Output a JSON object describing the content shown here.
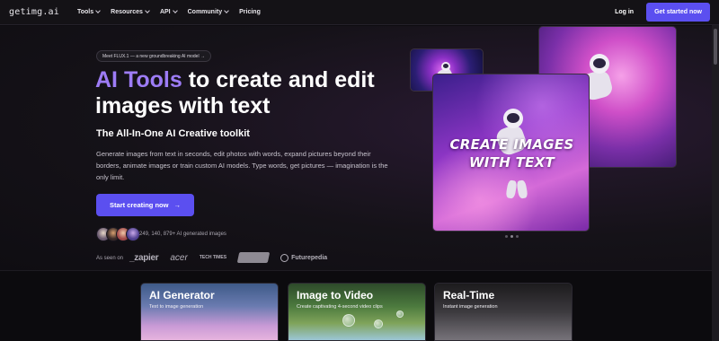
{
  "nav": {
    "logo": "getimg.ai",
    "items": [
      {
        "label": "Tools",
        "dropdown": true
      },
      {
        "label": "Resources",
        "dropdown": true
      },
      {
        "label": "API",
        "dropdown": true
      },
      {
        "label": "Community",
        "dropdown": true
      },
      {
        "label": "Pricing",
        "dropdown": false
      }
    ],
    "login": "Log in",
    "cta": "Get started now"
  },
  "hero": {
    "badge": "Meet FLUX.1 — a new groundbreaking AI model →",
    "title_accent": "AI Tools",
    "title_rest": " to create and edit images with text",
    "subtitle": "The All-In-One AI Creative toolkit",
    "description": "Generate images from text in seconds, edit photos with words, expand pictures beyond their borders, animate images or train custom AI models. Type words, get pictures — imagination is the only limit.",
    "cta": "Start creating now",
    "cta_arrow": "→",
    "users_count": "249, 140, 879+ AI generated images",
    "seen_on_label": "As seen on",
    "seen_on": [
      "_zapier",
      "acer",
      "TECH TIMES",
      "Futurepedia"
    ],
    "collage_text": "CREATE IMAGES WITH TEXT"
  },
  "features": [
    {
      "title": "AI Generator",
      "subtitle": "Text to image generation"
    },
    {
      "title": "Image to Video",
      "subtitle": "Create captivating 4-second video clips"
    },
    {
      "title": "Real-Time",
      "subtitle": "Instant image generation"
    }
  ],
  "colors": {
    "accent": "#5b4ff0",
    "title_accent": "#9d7cf6",
    "background": "#0d0b10"
  }
}
